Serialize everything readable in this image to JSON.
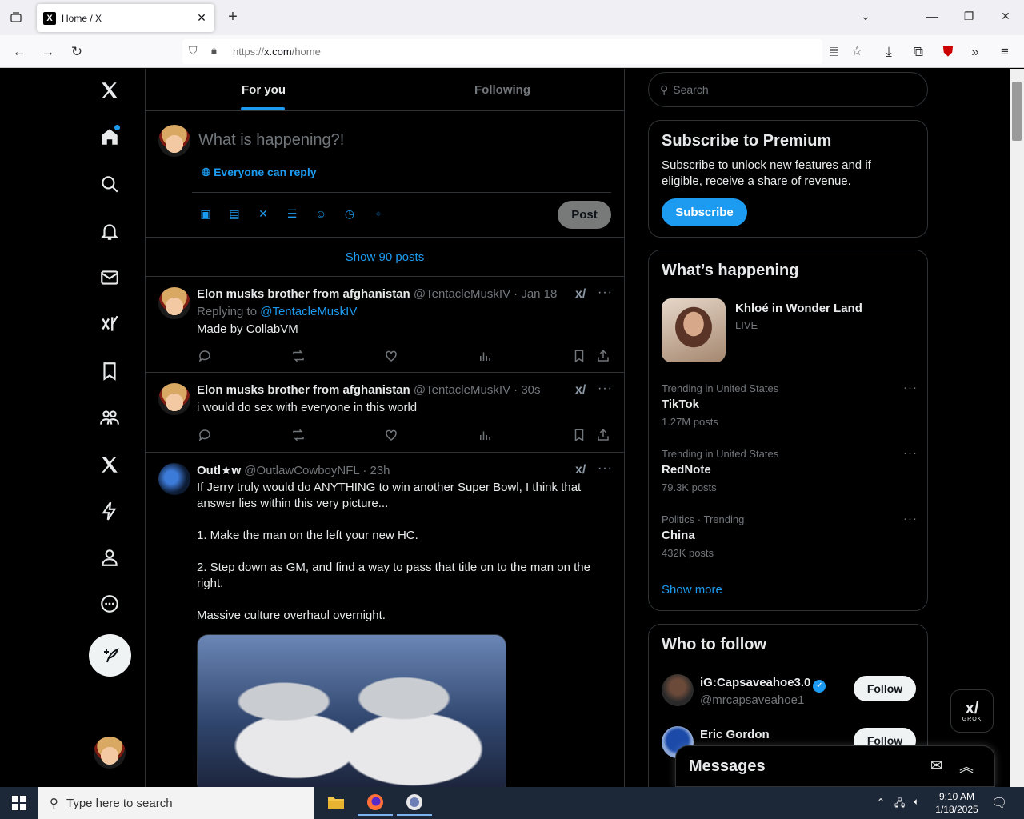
{
  "browser": {
    "tab_title": "Home / X",
    "favicon_text": "X",
    "url_prefix": "https://",
    "url_host": "x.com",
    "url_path": "/home"
  },
  "timeline": {
    "tabs": [
      "For you",
      "Following"
    ],
    "composer_placeholder": "What is happening?!",
    "reply_setting": "Everyone can reply",
    "post_label": "Post",
    "show_posts": "Show 90 posts"
  },
  "tweets": [
    {
      "name": "Elon musks brother from afghanistan",
      "handle_meta": "@TentacleMuskIV · Jan 18",
      "replying_prefix": "Replying to ",
      "replying_handle": "@TentacleMuskIV",
      "text": "Made by CollabVM"
    },
    {
      "name": "Elon musks brother from afghanistan",
      "handle_meta": "@TentacleMuskIV · 30s",
      "text": "i would do sex with everyone in this world"
    },
    {
      "name": "Outl★w",
      "handle_meta": "@OutlawCowboyNFL · 23h",
      "lines": [
        "If Jerry truly would do ANYTHING to win another Super Bowl, I think that",
        "answer lies within this very picture...",
        "1. Make the man on the left your new HC.",
        "2. Step down as GM, and find a way to pass that title on to the man on the",
        "right.",
        "Massive culture overhaul overnight."
      ]
    }
  ],
  "sidebar": {
    "search_placeholder": "Search",
    "premium": {
      "title": "Subscribe to Premium",
      "text": "Subscribe to unlock new features and if eligible, receive a share of revenue.",
      "button": "Subscribe"
    },
    "happening": {
      "title": "What’s happening",
      "live_title": "Khloé in Wonder Land",
      "live_badge": "LIVE",
      "trends": [
        {
          "context": "Trending in United States",
          "name": "TikTok",
          "count": "1.27M posts"
        },
        {
          "context": "Trending in United States",
          "name": "RedNote",
          "count": "79.3K posts"
        },
        {
          "context": "Politics · Trending",
          "name": "China",
          "count": "432K posts"
        }
      ],
      "show_more": "Show more"
    },
    "who_to_follow": {
      "title": "Who to follow",
      "users": [
        {
          "name": "iG:Capsaveahoe3.0",
          "handle": "@mrcapsaveahoe1",
          "follow": "Follow",
          "verified": true
        },
        {
          "name": "Eric Gordon",
          "handle": "",
          "follow": "Follow",
          "verified": false
        }
      ]
    }
  },
  "messages": {
    "title": "Messages"
  },
  "grok_float": {
    "logo": "x/",
    "label": "GROK"
  },
  "taskbar": {
    "search_placeholder": "Type here to search",
    "time": "9:10 AM",
    "date": "1/18/2025"
  },
  "colors": {
    "accent": "#1d9bf0",
    "background": "#000000",
    "border": "#2f3336",
    "muted": "#71767b"
  }
}
